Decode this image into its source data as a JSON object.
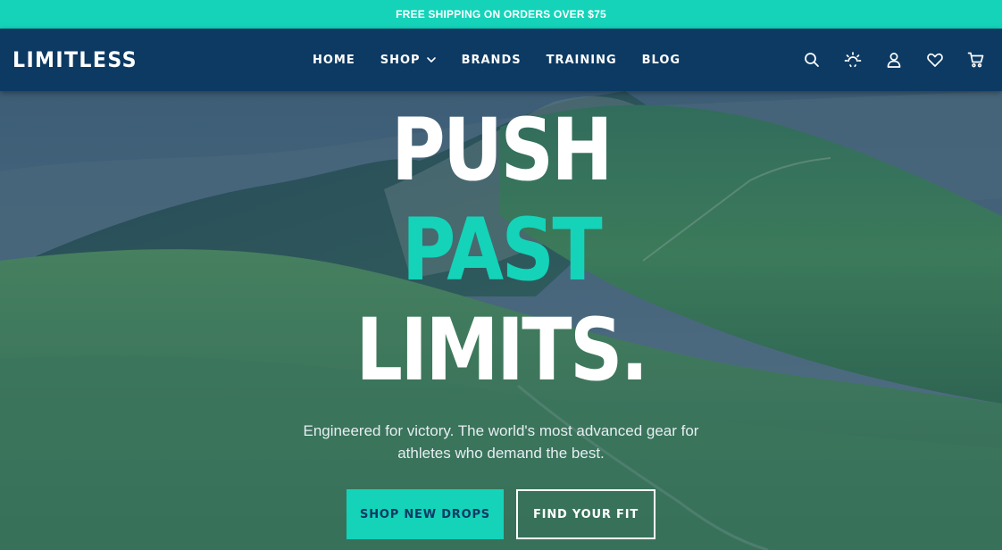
{
  "promo": {
    "text": "FREE SHIPPING ON ORDERS OVER $75"
  },
  "brand": {
    "logo_text": "LIMITLESS"
  },
  "nav": {
    "links": [
      "HOME",
      "SHOP",
      "BRANDS",
      "TRAINING",
      "BLOG"
    ],
    "icons": [
      "search-icon",
      "sun-icon",
      "user-icon",
      "heart-icon",
      "cart-icon"
    ]
  },
  "hero": {
    "headline_1": "PUSH",
    "headline_2": "PAST",
    "headline_3": "LIMITS.",
    "subtext": "Engineered for victory. The world's most advanced gear for athletes who demand the best.",
    "primary_button": "SHOP NEW DROPS",
    "secondary_button": "FIND YOUR FIT"
  },
  "colors": {
    "accent": "#14d3b9",
    "navbar": "#0c3a63",
    "text_light": "#ffffff"
  }
}
